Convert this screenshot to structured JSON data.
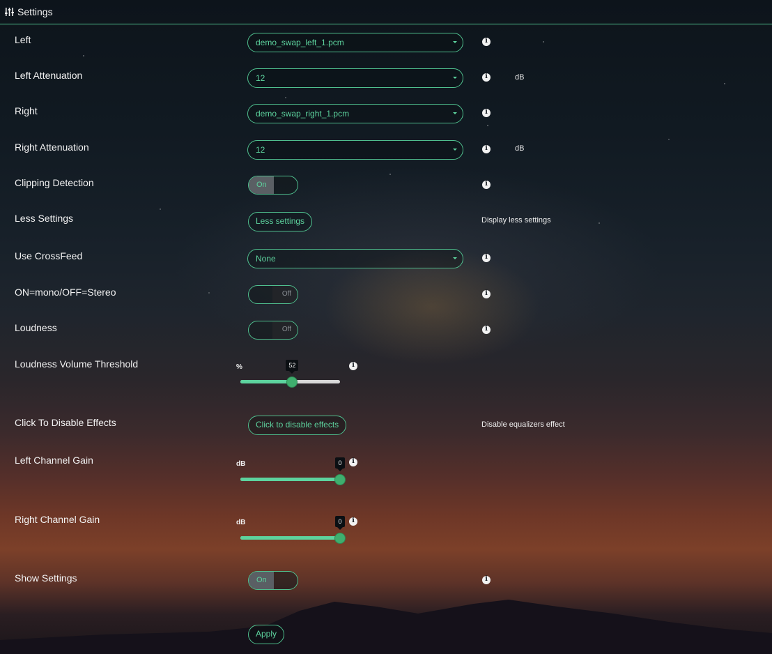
{
  "header": {
    "title": "Settings",
    "icon": "sliders-icon"
  },
  "rows": {
    "left": {
      "label": "Left",
      "value": "demo_swap_left_1.pcm"
    },
    "left_att": {
      "label": "Left Attenuation",
      "value": "12",
      "unit": "dB"
    },
    "right": {
      "label": "Right",
      "value": "demo_swap_right_1.pcm"
    },
    "right_att": {
      "label": "Right Attenuation",
      "value": "12",
      "unit": "dB"
    },
    "clipping": {
      "label": "Clipping Detection",
      "state": "On"
    },
    "less": {
      "label": "Less Settings",
      "button": "Less settings",
      "note": "Display less settings"
    },
    "crossfeed": {
      "label": "Use CrossFeed",
      "value": "None"
    },
    "mono": {
      "label": "ON=mono/OFF=Stereo",
      "state": "Off"
    },
    "loudness": {
      "label": "Loudness",
      "state": "Off"
    },
    "loud_thresh": {
      "label": "Loudness Volume Threshold",
      "unit": "%",
      "value": "52",
      "fraction": 0.52
    },
    "disable_fx": {
      "label": "Click To Disable Effects",
      "button": "Click to disable effects",
      "note": "Disable equalizers effect"
    },
    "left_gain": {
      "label": "Left Channel Gain",
      "unit": "dB",
      "value": "0",
      "fraction": 1.0
    },
    "right_gain": {
      "label": "Right Channel Gain",
      "unit": "dB",
      "value": "0",
      "fraction": 1.0
    },
    "show": {
      "label": "Show Settings",
      "state": "On"
    }
  },
  "apply_label": "Apply",
  "colors": {
    "accent": "#5dd39e",
    "border": "#4fbf8e",
    "thumb": "#3fae6e"
  }
}
